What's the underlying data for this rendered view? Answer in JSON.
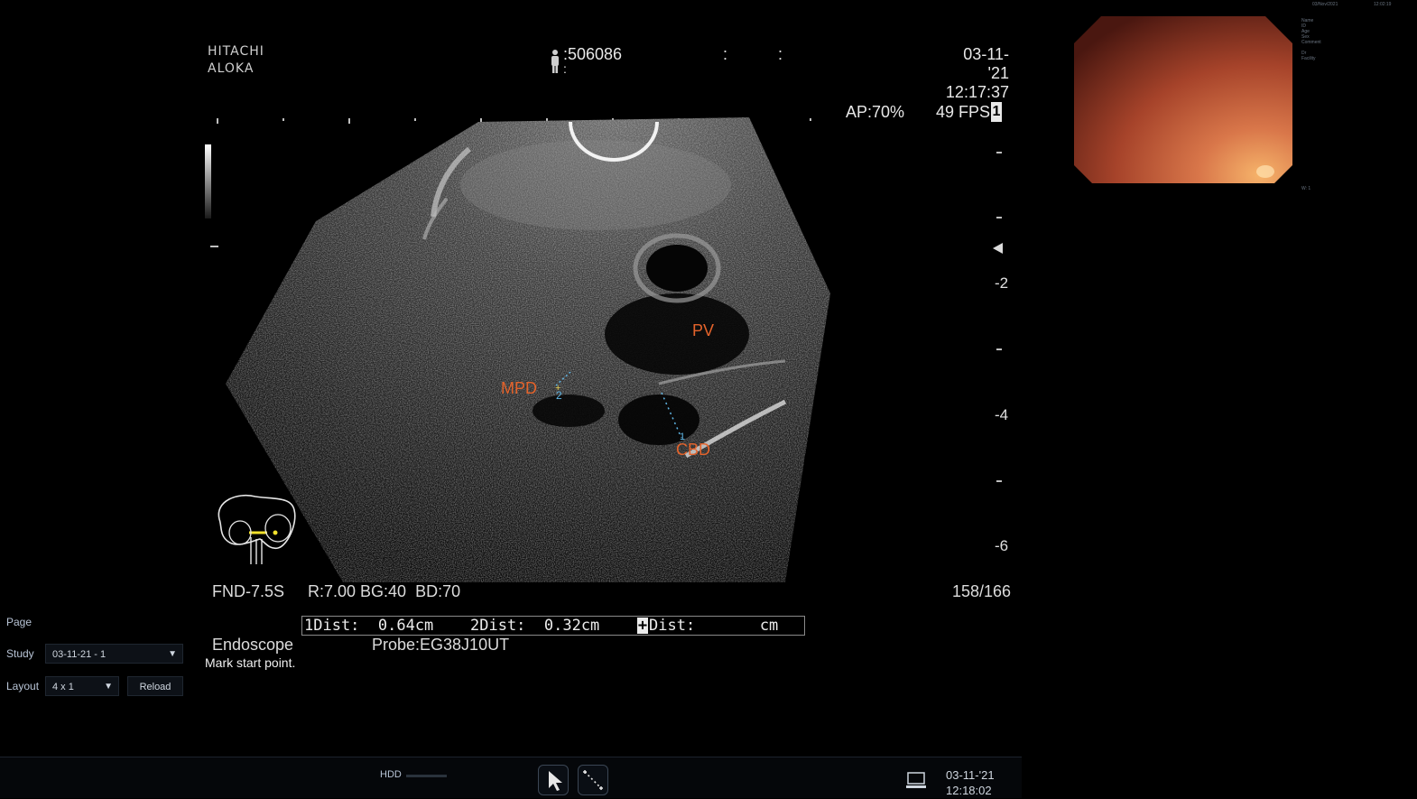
{
  "header": {
    "brand_line1": "HITACHI",
    "brand_line2": "ALOKA",
    "patient_id": ":506086",
    "patient_sub": ":",
    "colon_a": ":",
    "colon_b": ":",
    "date": "03-11-'21",
    "time": "12:17:37",
    "ap": "AP:70%",
    "fps": "49 FPS",
    "fps_badge": "1"
  },
  "image_labels": {
    "pv": "PV",
    "mpd": "MPD",
    "cbd": "CBD",
    "marker_1": "1",
    "marker_2": "2"
  },
  "depth_scale": {
    "labels": [
      "-2",
      "-4",
      "-6"
    ]
  },
  "info": {
    "probe_settings": "FND-7.5S",
    "params": "R:7.00 BG:40  BD:70",
    "frame_counter": "158/166",
    "measure_1": "1Dist:  0.64cm",
    "measure_2": "2Dist:  0.32cm",
    "measure_3": "Dist:       cm",
    "measure_3_prefix": "+",
    "mode": "Endoscope",
    "probe": "Probe:EG38J10UT",
    "status": "Mark start point."
  },
  "controls": {
    "page_label": "Page",
    "study_label": "Study",
    "study_value": "03-11-21 - 1",
    "layout_label": "Layout",
    "layout_value": "4 x 1",
    "reload_label": "Reload"
  },
  "bottom_bar": {
    "hdd_label": "HDD",
    "date": "03-11-'21",
    "time": "12:18:02"
  },
  "side_panel": {
    "top_date": "03/Nov/2021",
    "top_time": "12:02:19",
    "fields": [
      "Name",
      "ID",
      "Age",
      "Sex",
      "Comment",
      "Dr",
      "Facility"
    ],
    "bottom_note": "W: 1"
  },
  "colors": {
    "label_orange": "#e4632b",
    "caliper_blue": "#5fb6e6",
    "endoscope_warm": "#c8582a"
  }
}
